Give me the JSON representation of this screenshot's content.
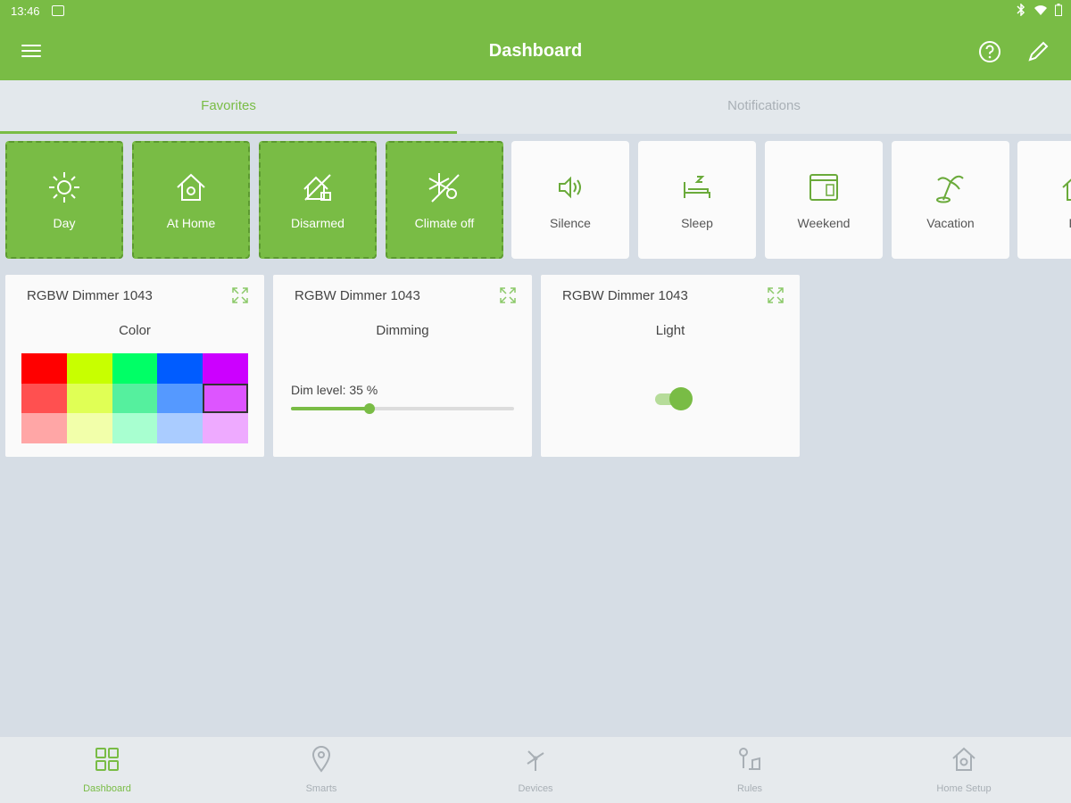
{
  "status_bar": {
    "time": "13:46"
  },
  "app_bar": {
    "title": "Dashboard"
  },
  "tabs": [
    {
      "label": "Favorites",
      "active": true
    },
    {
      "label": "Notifications",
      "active": false
    }
  ],
  "scenes": [
    {
      "label": "Day",
      "icon": "sun-icon",
      "active": true
    },
    {
      "label": "At Home",
      "icon": "home-icon",
      "active": true
    },
    {
      "label": "Disarmed",
      "icon": "shield-off-icon",
      "active": true
    },
    {
      "label": "Climate off",
      "icon": "snowflake-off-icon",
      "active": true
    },
    {
      "label": "Silence",
      "icon": "silence-icon",
      "active": false
    },
    {
      "label": "Sleep",
      "icon": "bed-icon",
      "active": false
    },
    {
      "label": "Weekend",
      "icon": "calendar-icon",
      "active": false
    },
    {
      "label": "Vacation",
      "icon": "palm-tree-icon",
      "active": false
    },
    {
      "label": "Pa",
      "icon": "home-icon",
      "active": false
    }
  ],
  "widgets": {
    "color": {
      "title": "RGBW Dimmer 1043",
      "subtitle": "Color",
      "colors": [
        "#ff0000",
        "#c8ff00",
        "#00ff66",
        "#005cff",
        "#cc00ff",
        "#ff5050",
        "#e0ff55",
        "#55f09e",
        "#5599ff",
        "#dd55ff",
        "#ffa6a6",
        "#f2ffaa",
        "#a8ffd0",
        "#aaccff",
        "#eeaaff"
      ],
      "selected_index": 9
    },
    "dimming": {
      "title": "RGBW Dimmer 1043",
      "subtitle": "Dimming",
      "level_label": "Dim level: 35 %",
      "level_percent": 35
    },
    "light": {
      "title": "RGBW Dimmer 1043",
      "subtitle": "Light",
      "on": true
    }
  },
  "bottom_nav": [
    {
      "label": "Dashboard",
      "icon": "dashboard-icon",
      "active": true
    },
    {
      "label": "Smarts",
      "icon": "location-pin-icon",
      "active": false
    },
    {
      "label": "Devices",
      "icon": "devices-icon",
      "active": false
    },
    {
      "label": "Rules",
      "icon": "rules-icon",
      "active": false
    },
    {
      "label": "Home Setup",
      "icon": "home-setup-icon",
      "active": false
    }
  ],
  "colors": {
    "accent": "#79bc45",
    "background": "#d6dde5"
  }
}
